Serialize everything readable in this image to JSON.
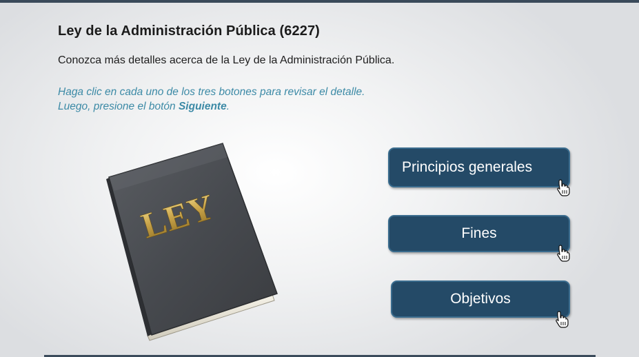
{
  "header": {
    "title": "Ley de la Administración Pública (6227)",
    "intro": "Conozca más detalles acerca de la Ley de la Administración Pública."
  },
  "instructions": {
    "line1": "Haga clic en cada uno de los tres botones para revisar el detalle.",
    "line2_prefix": "Luego, presione el botón ",
    "line2_bold": "Siguiente",
    "line2_suffix": "."
  },
  "book": {
    "label": "LEY",
    "icon": "law-book"
  },
  "buttons": [
    {
      "label": "Principios generales",
      "icon": "hand-pointer-icon"
    },
    {
      "label": "Fines",
      "icon": "hand-pointer-icon"
    },
    {
      "label": "Objetivos",
      "icon": "hand-pointer-icon"
    }
  ],
  "colors": {
    "button_bg": "#244a67",
    "button_border": "#3a6c8e",
    "instruction_text": "#3c8aa6",
    "book_cover": "#4a4d52",
    "book_gold": "#c9a44a"
  }
}
